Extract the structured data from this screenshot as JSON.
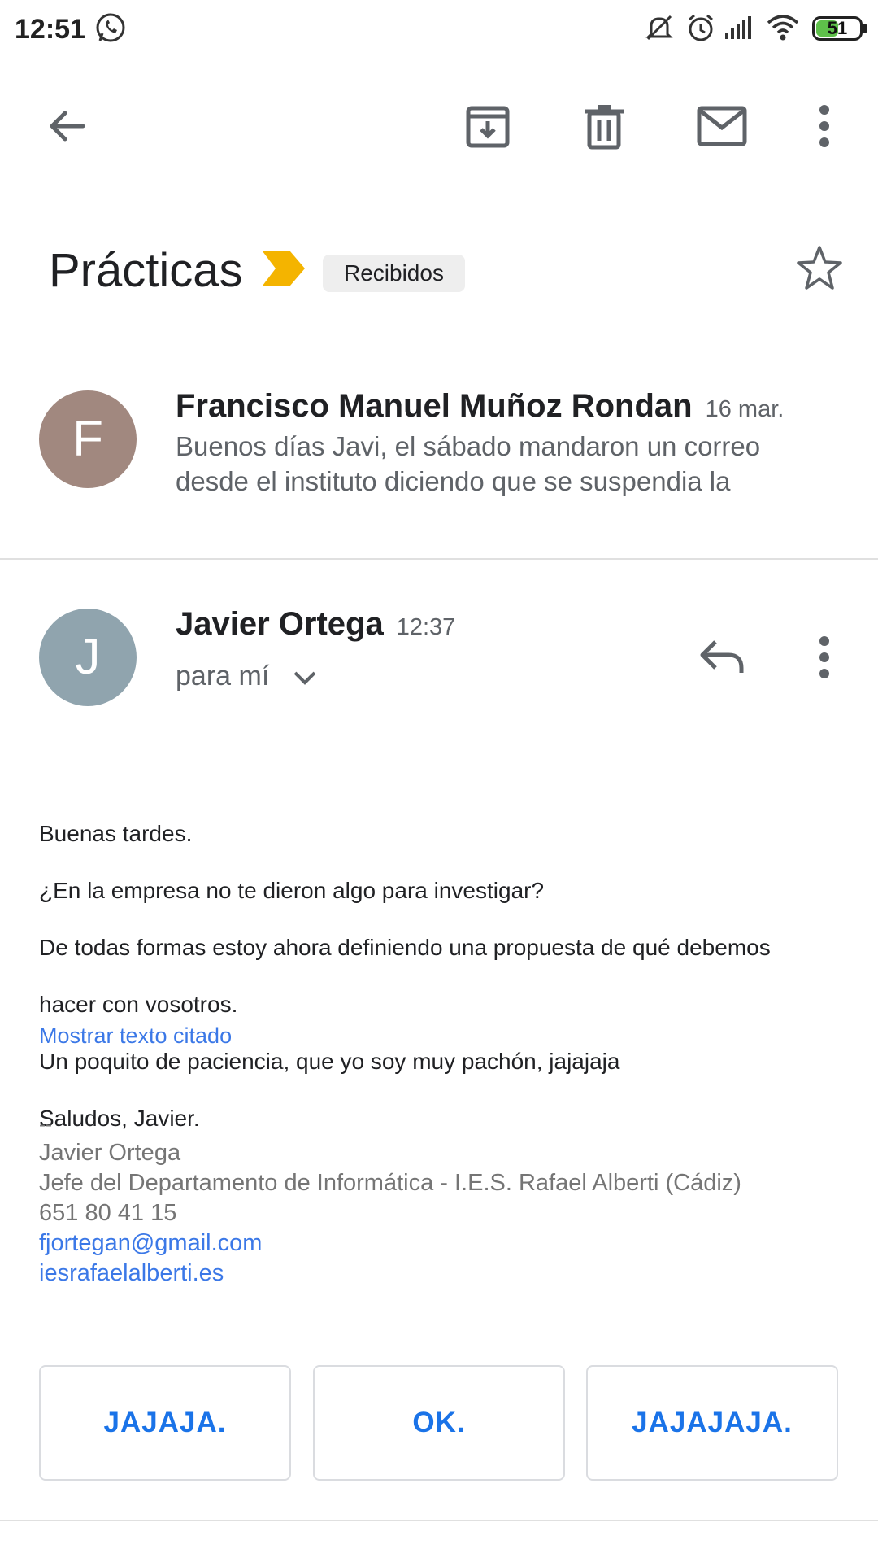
{
  "status_bar": {
    "time": "12:51",
    "battery_level": "51",
    "icons": [
      "whatsapp-icon",
      "silent-icon",
      "alarm-icon",
      "signal-icon",
      "wifi-icon",
      "battery-icon"
    ]
  },
  "toolbar": {
    "icons": [
      "back-arrow-icon",
      "archive-icon",
      "delete-icon",
      "mark-unread-icon",
      "more-vert-icon"
    ]
  },
  "thread": {
    "subject": "Prácticas",
    "label": "Recibidos",
    "importance_color": "#f4b400"
  },
  "messages": [
    {
      "avatar_letter": "F",
      "avatar_color": "#a1887f",
      "sender": "Francisco Manuel Muñoz Rondan",
      "date": "16 mar.",
      "snippet_lines": [
        "Buenos días Javi, el sábado mandaron un correo",
        "desde el instituto diciendo que se suspendia la"
      ]
    },
    {
      "avatar_letter": "J",
      "avatar_color": "#90a4ae",
      "sender": "Javier Ortega",
      "time": "12:37",
      "recipient": "para mí",
      "body_lines": [
        "Buenas tardes.",
        "¿En la empresa no te dieron algo para investigar?",
        "De todas formas estoy ahora definiendo una propuesta de qué debemos",
        "hacer con vosotros.",
        "Un poquito de paciencia, que yo soy muy pachón, jajajaja",
        "Saludos, Javier."
      ],
      "show_quoted": "Mostrar texto citado",
      "signature": {
        "separator": "--",
        "name": "Javier Ortega",
        "role": "Jefe del Departamento de Informática - I.E.S. Rafael Alberti (Cádiz)",
        "phone": "651 80 41 15",
        "email": "fjortegan@gmail.com",
        "website": "iesrafaelalberti.es"
      }
    }
  ],
  "smart_replies": [
    "JAJAJA.",
    "OK.",
    "JAJAJAJA."
  ],
  "colors": {
    "link": "#3b78e7",
    "smart_reply_text": "#1a73e8"
  }
}
